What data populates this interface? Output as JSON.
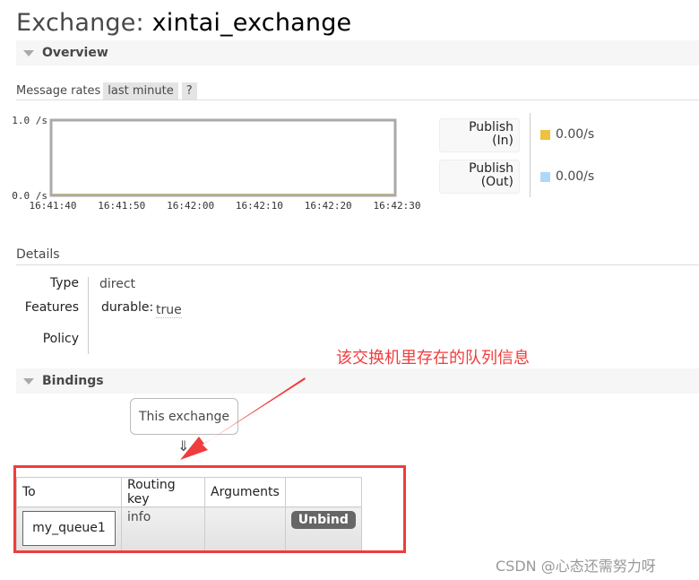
{
  "header": {
    "title_prefix": "Exchange:",
    "exchange_name": "xintai_exchange"
  },
  "overview": {
    "section_label": "Overview",
    "message_rates_label": "Message rates",
    "range_selector": "last minute",
    "help_label": "?",
    "legend": [
      {
        "label_line1": "Publish",
        "label_line2": "(In)",
        "value": "0.00/s",
        "color": "#edc240"
      },
      {
        "label_line1": "Publish",
        "label_line2": "(Out)",
        "value": "0.00/s",
        "color": "#afd8f8"
      }
    ]
  },
  "chart_data": {
    "type": "area",
    "title": "",
    "xlabel": "",
    "ylabel": "",
    "x_ticks": [
      "16:41:40",
      "16:41:50",
      "16:42:00",
      "16:42:10",
      "16:42:20",
      "16:42:30"
    ],
    "y_ticks": [
      "0.0 /s",
      "1.0 /s"
    ],
    "ylim": [
      0,
      1
    ],
    "grid": false,
    "series": [
      {
        "name": "Publish (In)",
        "color": "#edc240",
        "values": [
          0,
          0,
          0,
          0,
          0,
          0
        ]
      },
      {
        "name": "Publish (Out)",
        "color": "#afd8f8",
        "values": [
          0,
          0,
          0,
          0,
          0,
          0
        ]
      }
    ]
  },
  "details": {
    "section_label": "Details",
    "rows": [
      {
        "label": "Type",
        "value": "direct"
      },
      {
        "label": "Features",
        "key": "durable:",
        "value": "true"
      },
      {
        "label": "Policy",
        "value": ""
      }
    ]
  },
  "bindings": {
    "section_label": "Bindings",
    "source_label": "This exchange",
    "arrow": "⇓",
    "columns": [
      "To",
      "Routing key",
      "Arguments",
      ""
    ],
    "rows": [
      {
        "to": "my_queue1",
        "routing_key": "info",
        "arguments": "",
        "action": "Unbind"
      }
    ]
  },
  "annotation": {
    "text": "该交换机里存在的队列信息",
    "color": "#f03c3c"
  },
  "watermark": "CSDN @心态还需努力呀"
}
